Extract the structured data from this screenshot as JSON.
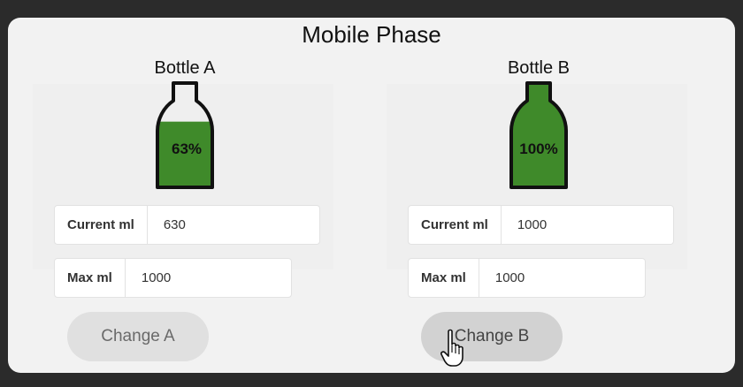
{
  "panel": {
    "title": "Mobile Phase"
  },
  "bottles": [
    {
      "name": "Bottle A",
      "fill_fraction": 0.63,
      "percent_label": "63%",
      "current_label": "Current ml",
      "current_value": "630",
      "max_label": "Max ml",
      "max_value": "1000",
      "button_label": "Change A"
    },
    {
      "name": "Bottle B",
      "fill_fraction": 1.0,
      "percent_label": "100%",
      "current_label": "Current ml",
      "current_value": "1000",
      "max_label": "Max ml",
      "max_value": "1000",
      "button_label": "Change B"
    }
  ],
  "colors": {
    "liquid": "#3f8a2a",
    "bottle_outline": "#111111",
    "panel_bg": "#f2f2f2",
    "page_bg": "#2b2b2b"
  },
  "cursor": {
    "icon": "hand-pointer-icon"
  }
}
